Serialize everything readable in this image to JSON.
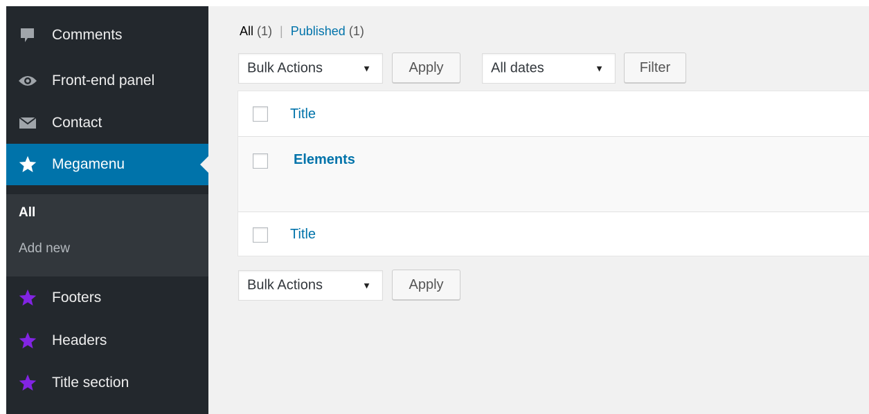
{
  "sidebar": {
    "items": [
      {
        "label": "Comments",
        "icon": "comment-icon"
      },
      {
        "label": "Front-end panel",
        "icon": "eye-icon"
      },
      {
        "label": "Contact",
        "icon": "envelope-icon"
      },
      {
        "label": "Megamenu",
        "icon": "star-icon"
      },
      {
        "label": "Footers",
        "icon": "star-icon"
      },
      {
        "label": "Headers",
        "icon": "star-icon"
      },
      {
        "label": "Title section",
        "icon": "star-icon"
      }
    ],
    "submenu": [
      {
        "label": "All"
      },
      {
        "label": "Add new"
      }
    ],
    "colors": {
      "background": "#23282d",
      "current": "#0073aa",
      "submenu": "#32373c",
      "star_purple": "#8224e3"
    }
  },
  "views": {
    "all_label": "All",
    "all_count": "(1)",
    "separator": "|",
    "published_label": "Published",
    "published_count": "(1)"
  },
  "top_actions": {
    "bulk_actions": "Bulk Actions",
    "apply": "Apply",
    "dates": "All dates",
    "filter": "Filter"
  },
  "table": {
    "header_title": "Title",
    "rows": [
      {
        "title": "Elements"
      }
    ],
    "footer_title": "Title"
  },
  "bottom_actions": {
    "bulk_actions": "Bulk Actions",
    "apply": "Apply"
  }
}
